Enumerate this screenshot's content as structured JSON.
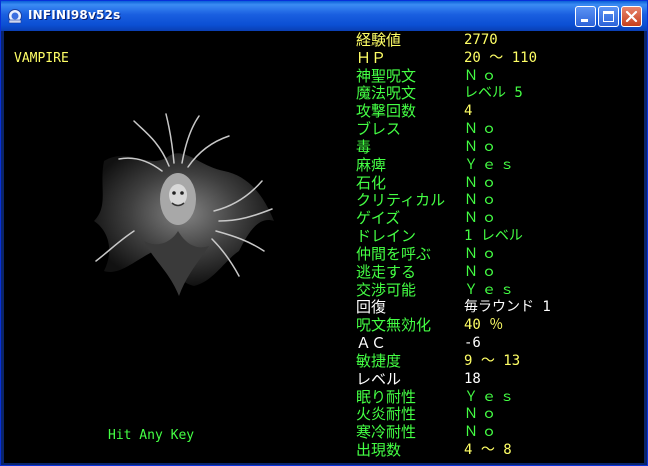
{
  "window": {
    "title": "INFINI98v52s"
  },
  "monster": {
    "name": "VAMPIRE"
  },
  "prompt": "Hit Any Key",
  "colors": {
    "yellow": "#ffff66",
    "green": "#44ff44",
    "white": "#ffffff",
    "background": "#000000"
  },
  "stats": [
    {
      "label": "経験値",
      "value": "2770",
      "color": "yellow"
    },
    {
      "label": "ＨＰ",
      "value": "20 ～ 110",
      "color": "yellow"
    },
    {
      "label": "神聖呪文",
      "value": "Ｎｏ",
      "color": "green"
    },
    {
      "label": "魔法呪文",
      "value": "レベル 5",
      "color": "green"
    },
    {
      "label": "攻撃回数",
      "value": "4",
      "color": "yellow"
    },
    {
      "label": "ブレス",
      "value": "Ｎｏ",
      "color": "green"
    },
    {
      "label": "毒",
      "value": "Ｎｏ",
      "color": "green"
    },
    {
      "label": "麻痺",
      "value": "Ｙｅｓ",
      "color": "green"
    },
    {
      "label": "石化",
      "value": "Ｎｏ",
      "color": "green"
    },
    {
      "label": "クリティカル",
      "value": "Ｎｏ",
      "color": "green"
    },
    {
      "label": "ゲイズ",
      "value": "Ｎｏ",
      "color": "green"
    },
    {
      "label": "ドレイン",
      "value": "1 レベル",
      "color": "green"
    },
    {
      "label": "仲間を呼ぶ",
      "value": "Ｎｏ",
      "color": "green"
    },
    {
      "label": "逃走する",
      "value": "Ｎｏ",
      "color": "green"
    },
    {
      "label": "交渉可能",
      "value": "Ｙｅｓ",
      "color": "green"
    },
    {
      "label": "回復",
      "value": "毎ラウンド 1",
      "color": "white"
    },
    {
      "label": "呪文無効化",
      "value": "40 ％",
      "color": "yellow"
    },
    {
      "label": "ＡＣ",
      "value": "-6",
      "color": "white"
    },
    {
      "label": "敏捷度",
      "value": "9 ～ 13",
      "color": "yellow"
    },
    {
      "label": "レベル",
      "value": "18",
      "color": "white"
    },
    {
      "label": "眠り耐性",
      "value": "Ｙｅｓ",
      "color": "green"
    },
    {
      "label": "火炎耐性",
      "value": "Ｎｏ",
      "color": "green"
    },
    {
      "label": "寒冷耐性",
      "value": "Ｎｏ",
      "color": "green"
    },
    {
      "label": "出現数",
      "value": "4 ～ 8",
      "color": "yellow"
    }
  ]
}
